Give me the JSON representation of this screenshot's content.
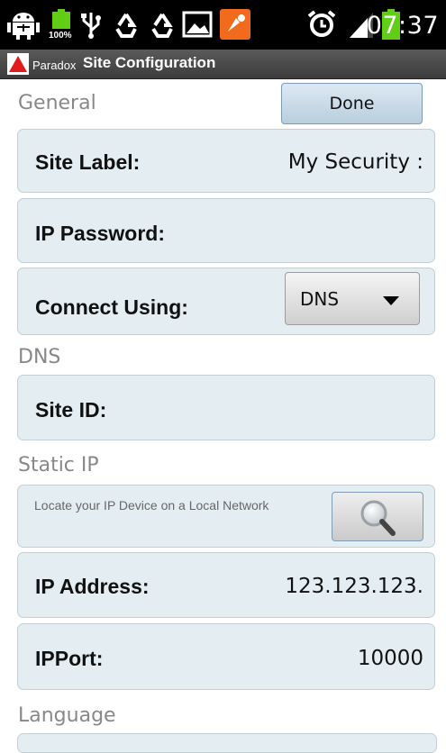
{
  "status_bar": {
    "battery_small_label": "100%",
    "time": "07:37"
  },
  "title_bar": {
    "app_name": "Paradox",
    "screen_title": "Site Configuration"
  },
  "general": {
    "header": "General",
    "done_label": "Done",
    "site_label": {
      "label": "Site Label:",
      "value": "My Security :"
    },
    "ip_password": {
      "label": "IP Password:",
      "value": ""
    },
    "connect_using": {
      "label": "Connect Using:",
      "selected": "DNS"
    }
  },
  "dns": {
    "header": "DNS",
    "site_id": {
      "label": "Site ID:",
      "value": ""
    }
  },
  "static_ip": {
    "header": "Static IP",
    "locate_text": "Locate your IP Device on a Local Network",
    "ip_address": {
      "label": "IP Address:",
      "value": "123.123.123."
    },
    "ip_port": {
      "label": "IPPort:",
      "value": "10000"
    }
  },
  "language": {
    "header": "Language"
  },
  "colors": {
    "row_bg": "#e4eef2",
    "accent_orange": "#f26a1b",
    "logo_red": "#e21b1b",
    "battery_green": "#5fce15"
  }
}
